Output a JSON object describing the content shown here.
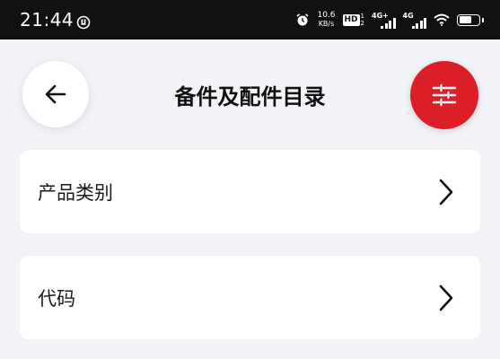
{
  "status_bar": {
    "time": "21:44",
    "net_speed_value": "10.6",
    "net_speed_unit": "KB/s",
    "hd_label": "HD",
    "hd_sub_top": "1",
    "hd_sub_bottom": "2",
    "sim1_label": "4G+",
    "sim2_label": "4G",
    "battery_level_percent": 65
  },
  "header": {
    "title": "备件及配件目录",
    "back_icon": "arrow-left-icon",
    "filter_icon": "sliders-icon",
    "accent_color": "#dc1e27"
  },
  "menu": {
    "items": [
      {
        "label": "产品类别",
        "icon": "chevron-right-icon"
      },
      {
        "label": "代码",
        "icon": "chevron-right-icon"
      }
    ]
  }
}
